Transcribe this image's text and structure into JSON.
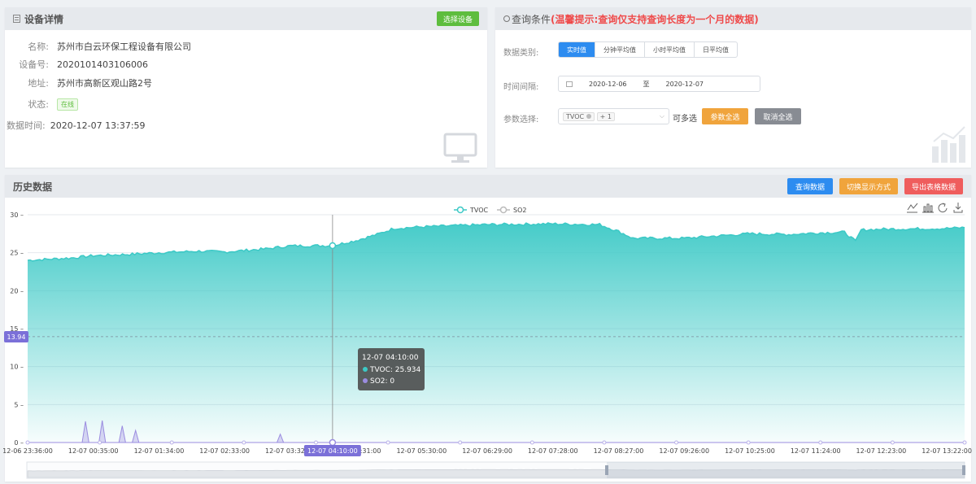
{
  "device": {
    "title": "设备详情",
    "select_button": "选择设备",
    "name_label": "名称:",
    "name_value": "苏州市白云环保工程设备有限公司",
    "code_label": "设备号:",
    "code_value": "2020101403106006",
    "addr_label": "地址:",
    "addr_value": "苏州市高新区观山路2号",
    "status_label": "状态:",
    "status_value": "在线",
    "time_label": "数据时间:",
    "time_value": "2020-12-07 13:37:59"
  },
  "query": {
    "title": "查询条件",
    "tip": "(温馨提示:查询仅支持查询长度为一个月的数据)",
    "type_label": "数据类别:",
    "type_options": [
      "实时值",
      "分钟平均值",
      "小时平均值",
      "日平均值"
    ],
    "interval_label": "时间间隔:",
    "date_start": "2020-12-06",
    "date_sep": "至",
    "date_end": "2020-12-07",
    "param_label": "参数选择:",
    "param_chip": "TVOC",
    "param_more": "+ 1",
    "multi_label": "可多选",
    "select_all": "参数全选",
    "cancel_all": "取消全选"
  },
  "history": {
    "title": "历史数据",
    "query_button": "查询数据",
    "switch_button": "切换显示方式",
    "export_button": "导出表格数据"
  },
  "colors": {
    "tvoc": "#3cc9c6",
    "so2": "#9b8ce0",
    "mark": "#7b70d8"
  },
  "chart_data": {
    "type": "area",
    "legend": [
      "TVOC",
      "SO2"
    ],
    "legend_position": "top-center",
    "ylim": [
      0,
      30
    ],
    "yticks": [
      0,
      5,
      10,
      15,
      20,
      25,
      30
    ],
    "x_tick_labels": [
      "12-06 23:36:00",
      "12-07 00:35:00",
      "12-07 01:34:00",
      "12-07 02:33:00",
      "12-07 03:32:00",
      "12-07 04:31:00",
      "12-07 05:30:00",
      "12-07 06:29:00",
      "12-07 07:28:00",
      "12-07 08:27:00",
      "12-07 09:26:00",
      "12-07 10:25:00",
      "12-07 11:24:00",
      "12-07 12:23:00",
      "12-07 13:22:00"
    ],
    "x_range": [
      "12-06 23:36:00",
      "12-07 13:37:59"
    ],
    "series": [
      {
        "name": "TVOC",
        "points": [
          [
            "12-06 23:36:00",
            24.0
          ],
          [
            "12-07 00:15:00",
            24.3
          ],
          [
            "12-07 00:35:00",
            24.6
          ],
          [
            "12-07 01:10:00",
            24.8
          ],
          [
            "12-07 01:34:00",
            25.0
          ],
          [
            "12-07 02:10:00",
            25.2
          ],
          [
            "12-07 02:33:00",
            25.1
          ],
          [
            "12-07 03:10:00",
            25.5
          ],
          [
            "12-07 03:32:00",
            25.9
          ],
          [
            "12-07 04:10:00",
            25.934
          ],
          [
            "12-07 04:31:00",
            26.6
          ],
          [
            "12-07 04:50:00",
            27.4
          ],
          [
            "12-07 05:05:00",
            28.2
          ],
          [
            "12-07 05:30:00",
            28.4
          ],
          [
            "12-07 06:29:00",
            28.7
          ],
          [
            "12-07 07:28:00",
            28.8
          ],
          [
            "12-07 08:10:00",
            28.7
          ],
          [
            "12-07 08:27:00",
            27.8
          ],
          [
            "12-07 08:40:00",
            26.9
          ],
          [
            "12-07 09:26:00",
            26.9
          ],
          [
            "12-07 09:55:00",
            27.2
          ],
          [
            "12-07 10:25:00",
            27.5
          ],
          [
            "12-07 11:00:00",
            27.4
          ],
          [
            "12-07 11:24:00",
            27.6
          ],
          [
            "12-07 11:50:00",
            27.7
          ],
          [
            "12-07 12:00:00",
            26.5
          ],
          [
            "12-07 12:05:00",
            28.0
          ],
          [
            "12-07 12:23:00",
            28.1
          ],
          [
            "12-07 13:22:00",
            28.2
          ],
          [
            "12-07 13:37:59",
            28.3
          ]
        ]
      },
      {
        "name": "SO2",
        "points": [
          [
            "12-06 23:36:00",
            0
          ],
          [
            "12-07 00:25:00",
            0
          ],
          [
            "12-07 00:28:00",
            2.8
          ],
          [
            "12-07 00:31:00",
            0
          ],
          [
            "12-07 00:40:00",
            0
          ],
          [
            "12-07 00:43:00",
            2.9
          ],
          [
            "12-07 00:46:00",
            0
          ],
          [
            "12-07 00:58:00",
            0
          ],
          [
            "12-07 01:01:00",
            2.2
          ],
          [
            "12-07 01:04:00",
            0
          ],
          [
            "12-07 01:10:00",
            0
          ],
          [
            "12-07 01:13:00",
            1.6
          ],
          [
            "12-07 01:16:00",
            0
          ],
          [
            "12-07 03:20:00",
            0
          ],
          [
            "12-07 03:23:00",
            1.1
          ],
          [
            "12-07 03:26:00",
            0
          ],
          [
            "12-07 13:37:59",
            0
          ]
        ]
      }
    ],
    "avg_line": 13.94,
    "tooltip": {
      "time": "12-07 04:10:00",
      "tvoc_label": "TVOC: 25.934",
      "so2_label": "SO2: 0"
    },
    "pointer_label": "12-07 04:10:00"
  }
}
